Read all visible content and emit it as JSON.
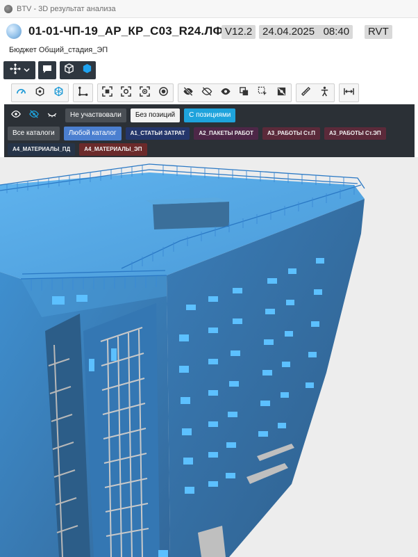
{
  "window": {
    "title": "BTV - 3D результат анализа"
  },
  "header": {
    "model_name": "01-01-ЧП-19_АР_КР_С03_R24.ЛФ",
    "version": "V12.2",
    "datetime": "24.04.2025   08:40",
    "format": "RVT",
    "subtitle": "Бюджет Общий_стадия_ЭП"
  },
  "toolbar_a": {
    "icons": [
      "orbit-icon",
      "chevron-down-icon",
      "comment-icon",
      "cube-outline-icon",
      "cube-filled-icon"
    ]
  },
  "toolbar_b": {
    "groups": [
      [
        "speedometer-icon",
        "hexagon-icon",
        "network-hex-icon"
      ],
      [
        "axis-points-icon"
      ],
      [
        "fit-view-icon",
        "focus-frame-icon",
        "focus-circle-icon",
        "target-icon"
      ],
      [
        "eye-slash-icon",
        "eye-slash-outline-icon",
        "eye-icon",
        "isolate-icon",
        "select-area-icon",
        "hide-selected-icon"
      ],
      [
        "ruler-icon",
        "person-level-icon"
      ],
      [
        "width-measure-icon"
      ]
    ]
  },
  "filter": {
    "visibility_icons": [
      "eye-icon",
      "eye-crossed-icon",
      "eye-closed-icon"
    ],
    "states": [
      {
        "label": "Не участвовали",
        "bg": "#4a4f55"
      },
      {
        "label": "Без позиций",
        "bg": "#f2f2f2"
      },
      {
        "label": "С позициями",
        "bg": "#1ea3dc"
      }
    ],
    "catalogs": [
      {
        "label": "Все каталоги",
        "bg": "#4a4f55"
      },
      {
        "label": "Любой каталог",
        "bg": "#4b7fd0"
      },
      {
        "label": "А1_СТАТЬИ ЗАТРАТ",
        "bg": "#24366b"
      },
      {
        "label": "А2_ПАКЕТЫ РАБОТ",
        "bg": "#4d2747"
      },
      {
        "label": "А3_РАБОТЫ Ст.П",
        "bg": "#5b2a3a"
      },
      {
        "label": "А3_РАБОТЫ Ст.ЭП",
        "bg": "#5b2a3a"
      },
      {
        "label": "А4_МАТЕРИАЛЫ_ПД",
        "bg": "#263448"
      },
      {
        "label": "А4_МАТЕРИАЛЫ_ЭП",
        "bg": "#6b2a2a"
      }
    ]
  },
  "viewport": {
    "model_color": "#3d8fd2",
    "accent_color": "#5cc0ff"
  }
}
